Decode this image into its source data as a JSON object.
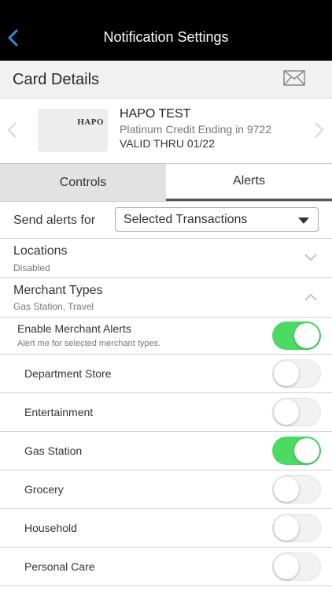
{
  "header": {
    "title": "Notification Settings",
    "back_icon": "chevron-left-icon",
    "background": "#000000"
  },
  "section": {
    "title": "Card Details",
    "mail_icon": "envelope-icon"
  },
  "card": {
    "logo_text": "HAPO",
    "name": "HAPO TEST",
    "description": "Platinum Credit Ending in 9722",
    "valid": "VALID THRU 01/22"
  },
  "tabs": [
    {
      "label": "Controls",
      "selected": false
    },
    {
      "label": "Alerts",
      "selected": true
    }
  ],
  "send_alerts": {
    "label": "Send alerts for",
    "selected": "Selected Transactions"
  },
  "locations": {
    "title": "Locations",
    "subtitle": "Disabled",
    "expanded": false
  },
  "merchant_types": {
    "title": "Merchant Types",
    "subtitle": "Gas Station, Travel",
    "expanded": true
  },
  "enable_merchant_alerts": {
    "title": "Enable Merchant Alerts",
    "subtitle": "Alert me for selected merchant types.",
    "on": true
  },
  "merchants": [
    {
      "label": "Department Store",
      "on": false
    },
    {
      "label": "Entertainment",
      "on": false
    },
    {
      "label": "Gas Station",
      "on": true
    },
    {
      "label": "Grocery",
      "on": false
    },
    {
      "label": "Household",
      "on": false
    },
    {
      "label": "Personal Care",
      "on": false
    }
  ],
  "colors": {
    "accent": "#2f8fd6",
    "toggle_on": "#4cd964"
  }
}
